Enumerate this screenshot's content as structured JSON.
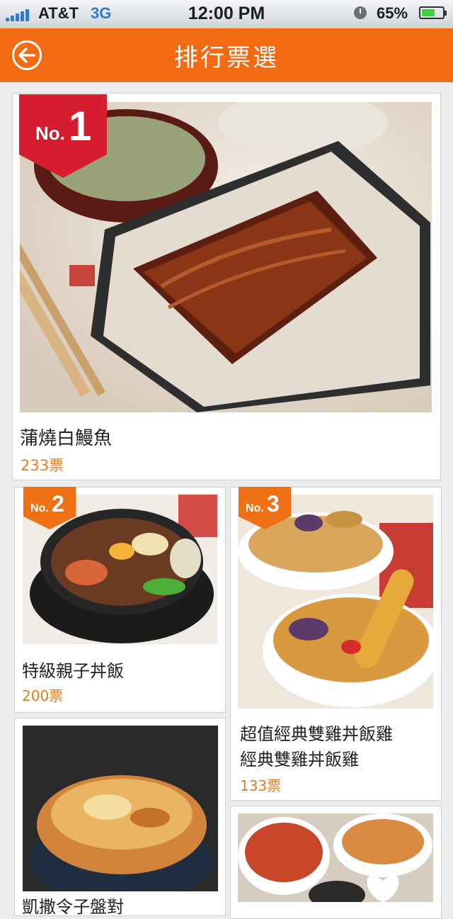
{
  "status_bar": {
    "carrier": "AT&T",
    "network": "3G",
    "time": "12:00 PM",
    "battery": "65%",
    "battery_level": 0.65
  },
  "header": {
    "title": "排行票選",
    "back_icon": "back-arrow-icon"
  },
  "items": [
    {
      "rank_prefix": "No.",
      "rank": "1",
      "name": "蒲燒白鰻魚",
      "votes": "233票"
    },
    {
      "rank_prefix": "No.",
      "rank": "2",
      "name": "特級親子丼飯",
      "votes": "200票"
    },
    {
      "rank_prefix": "No.",
      "rank": "3",
      "name_line1": "超值經典雙雞丼飯雞",
      "name_line2": "經典雙雞丼飯雞",
      "votes": "133票"
    },
    {
      "name": "凱撒令子盤對"
    }
  ],
  "colors": {
    "accent": "#f26b12",
    "votes": "#ef7b1c",
    "badge_top": "#d51d2f",
    "badge": "#f07016"
  }
}
